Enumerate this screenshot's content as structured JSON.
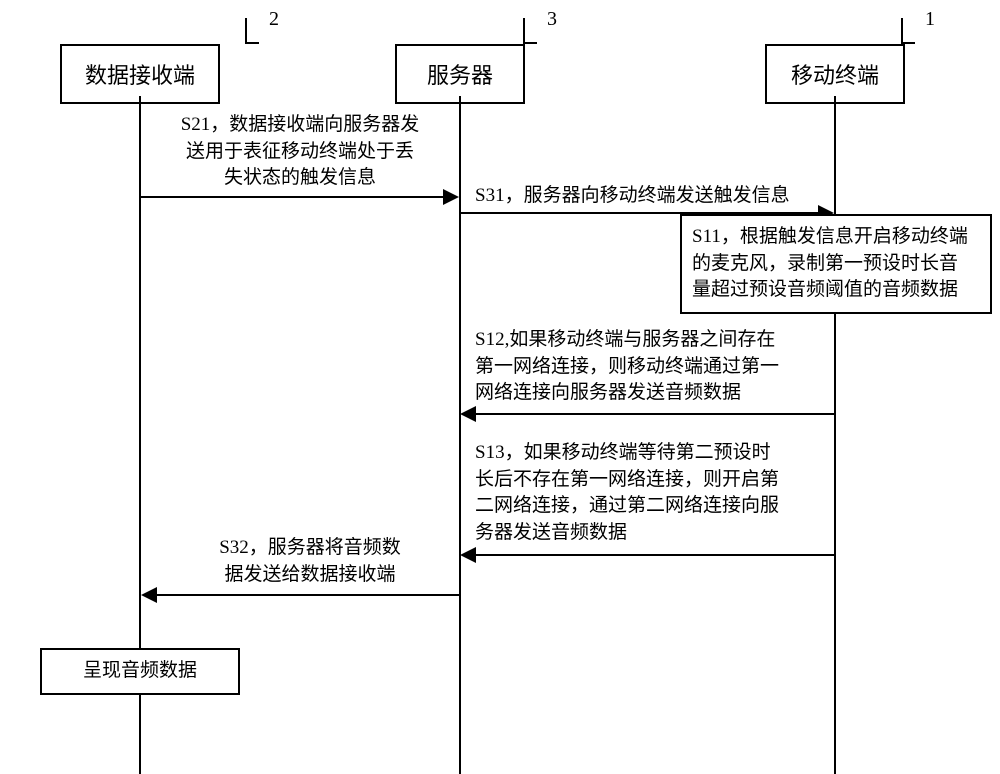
{
  "actors": {
    "receiver": {
      "label": "数据接收端",
      "number": "2"
    },
    "server": {
      "label": "服务器",
      "number": "3"
    },
    "terminal": {
      "label": "移动终端",
      "number": "1"
    }
  },
  "messages": {
    "s21": "S21，数据接收端向服务器发\n送用于表征移动终端处于丢\n失状态的触发信息",
    "s31": "S31，服务器向移动终端发送触发信息",
    "s11": "S11，根据触发信息开启移动终端\n的麦克风，录制第一预设时长音\n量超过预设音频阈值的音频数据",
    "s12": "S12,如果移动终端与服务器之间存在\n第一网络连接，则移动终端通过第一\n网络连接向服务器发送音频数据",
    "s13": "S13，如果移动终端等待第二预设时\n长后不存在第一网络连接，则开启第\n二网络连接，通过第二网络连接向服\n务器发送音频数据",
    "s32": "S32，服务器将音频数\n据发送给数据接收端"
  },
  "finalBox": "呈现音频数据"
}
